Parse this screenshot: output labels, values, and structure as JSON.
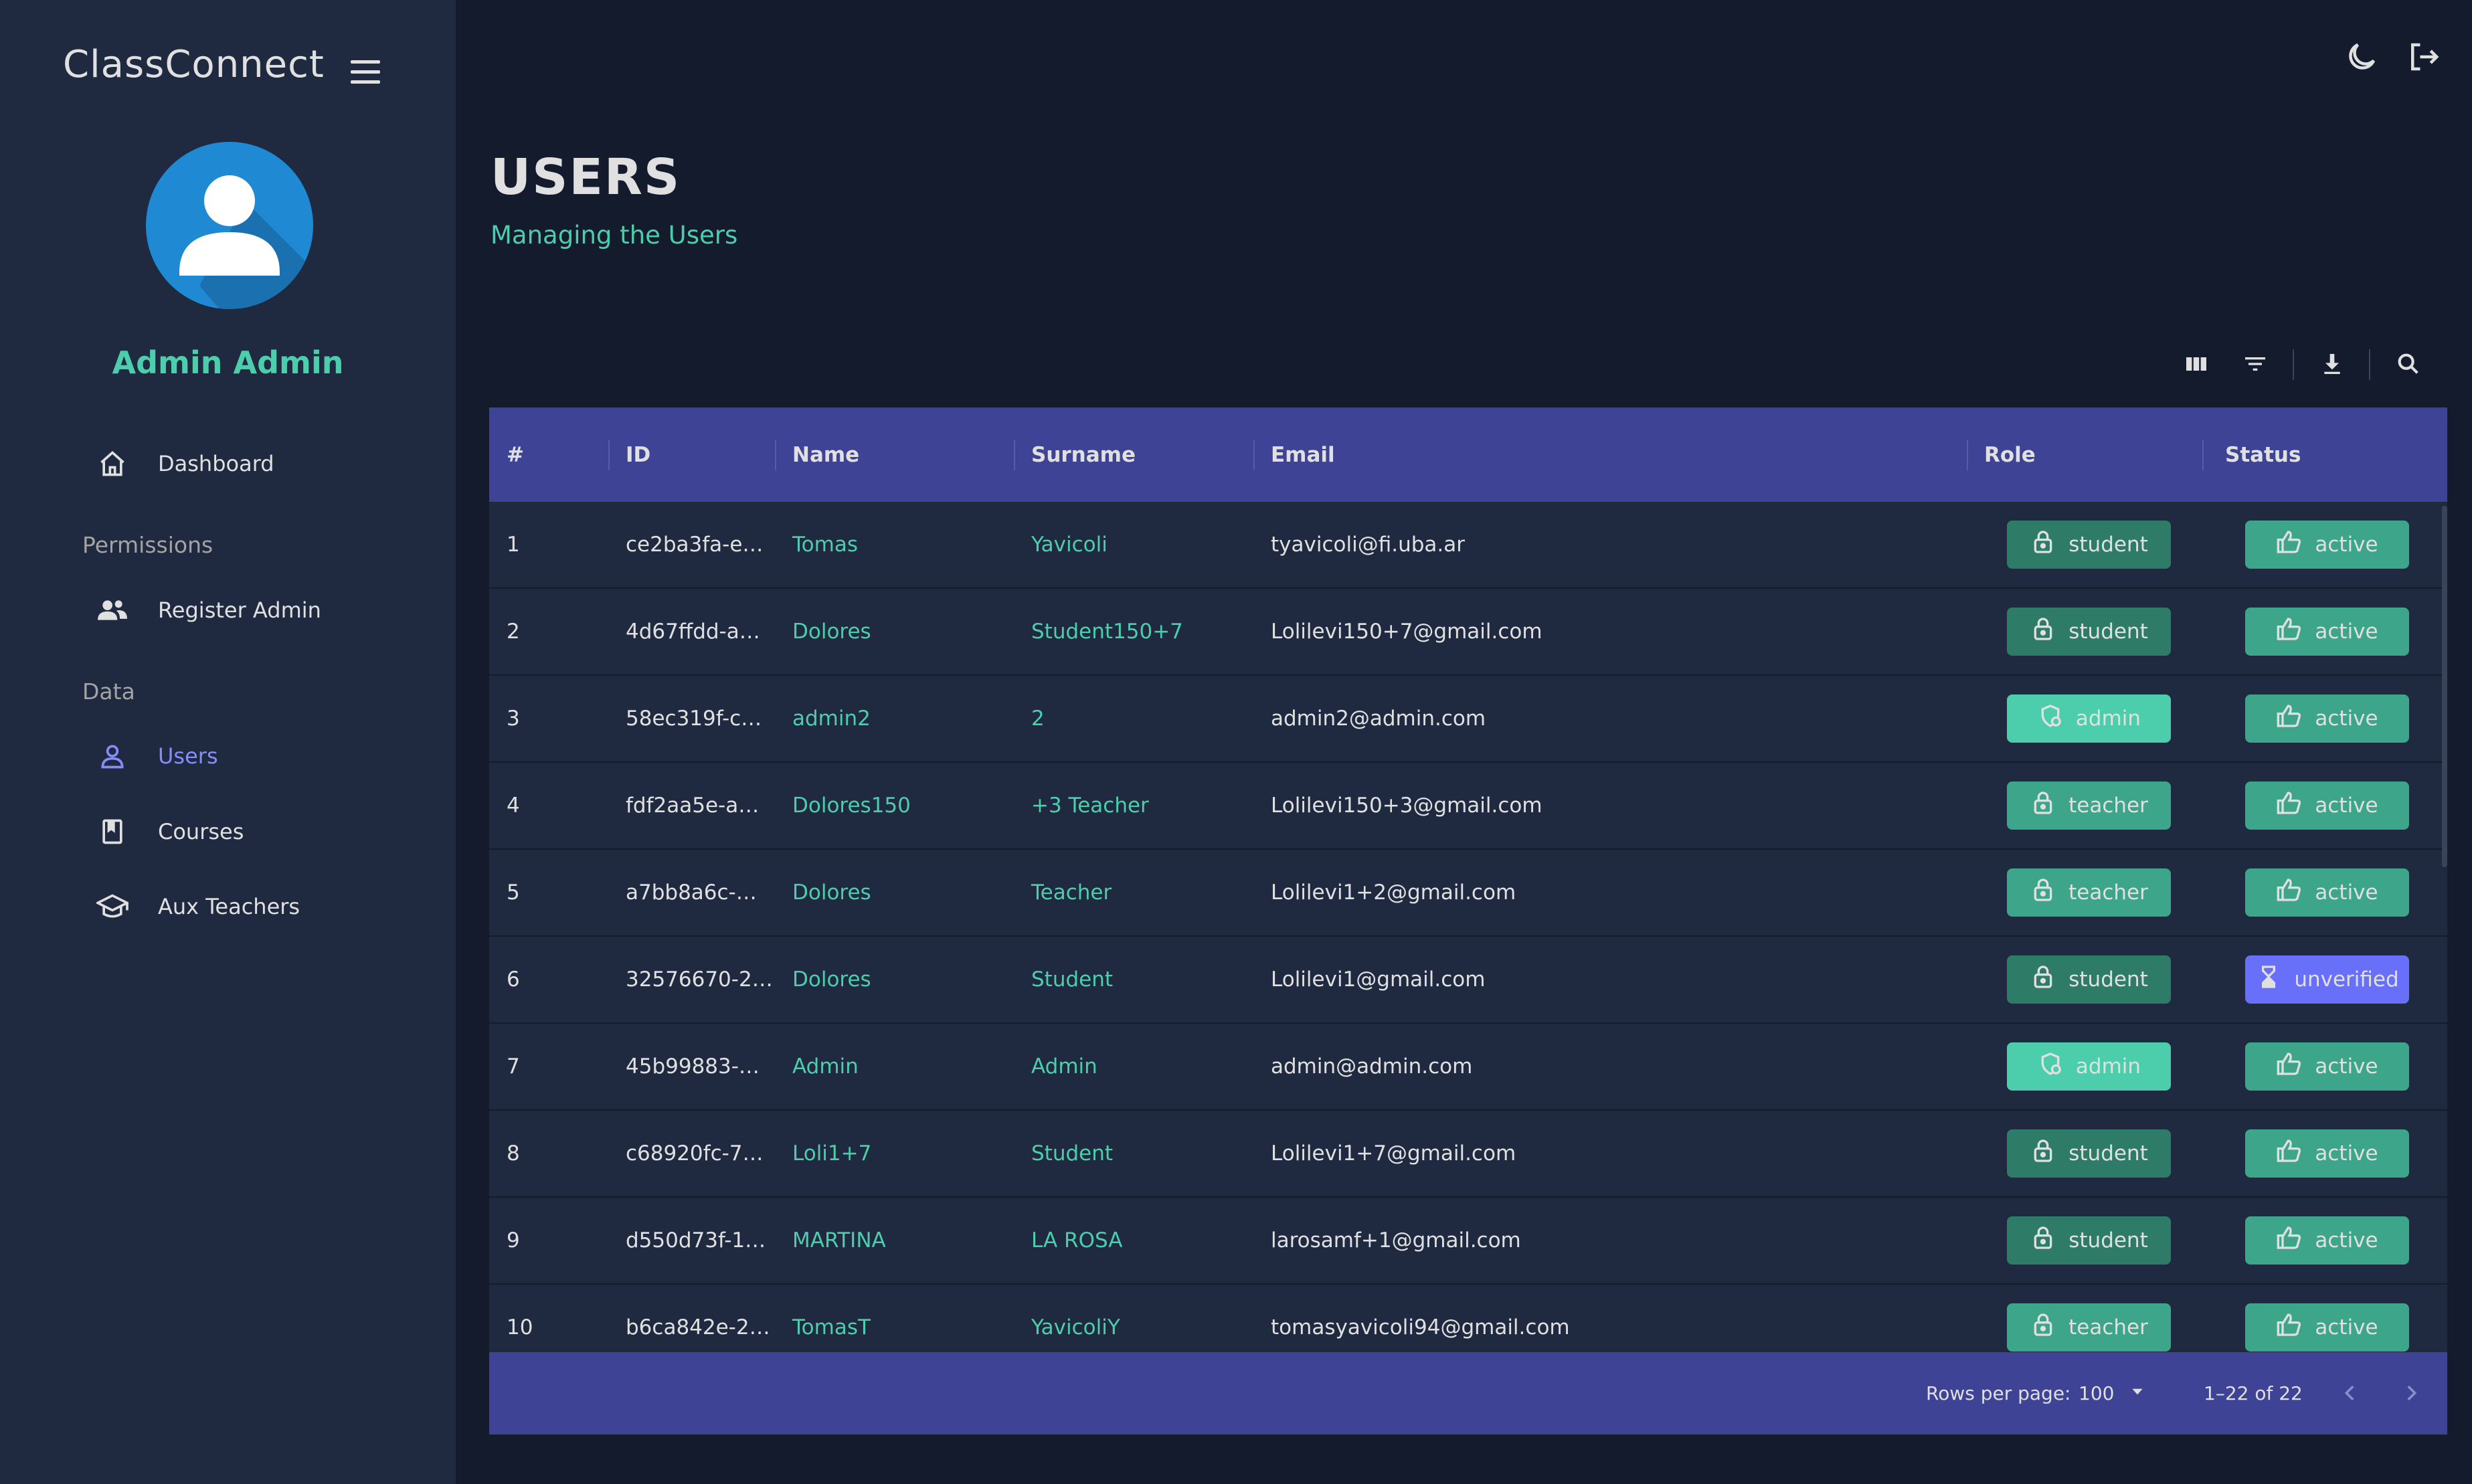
{
  "app": {
    "brand": "ClassConnect"
  },
  "profile": {
    "name": "Admin Admin"
  },
  "sidebar": {
    "items": [
      {
        "label": "Dashboard",
        "icon": "home-icon"
      },
      {
        "section": "Permissions"
      },
      {
        "label": "Register Admin",
        "icon": "people-icon"
      },
      {
        "section": "Data"
      },
      {
        "label": "Users",
        "icon": "person-icon",
        "active": true
      },
      {
        "label": "Courses",
        "icon": "book-icon"
      },
      {
        "label": "Aux Teachers",
        "icon": "school-icon"
      }
    ]
  },
  "topbar": {
    "icons": [
      "dark-mode-icon",
      "logout-icon"
    ]
  },
  "header": {
    "title": "USERS",
    "subtitle": "Managing the Users"
  },
  "toolbar": {
    "icons": [
      "columns-icon",
      "filter-icon",
      "download-icon",
      "search-icon"
    ]
  },
  "table": {
    "columns": [
      "#",
      "ID",
      "Name",
      "Surname",
      "Email",
      "Role",
      "Status"
    ],
    "rows": [
      {
        "n": "1",
        "id": "ce2ba3fa-e…",
        "name": "Tomas",
        "surname": "Yavicoli",
        "email": "tyavicoli@fi.uba.ar",
        "role": "student",
        "status": "active"
      },
      {
        "n": "2",
        "id": "4d67ffdd-a…",
        "name": "Dolores",
        "surname": "Student150+7",
        "email": "Lolilevi150+7@gmail.com",
        "role": "student",
        "status": "active"
      },
      {
        "n": "3",
        "id": "58ec319f-c…",
        "name": "admin2",
        "surname": "2",
        "email": "admin2@admin.com",
        "role": "admin",
        "status": "active"
      },
      {
        "n": "4",
        "id": "fdf2aa5e-a…",
        "name": "Dolores150",
        "surname": "+3 Teacher",
        "email": "Lolilevi150+3@gmail.com",
        "role": "teacher",
        "status": "active"
      },
      {
        "n": "5",
        "id": "a7bb8a6c-…",
        "name": "Dolores",
        "surname": "Teacher",
        "email": "Lolilevi1+2@gmail.com",
        "role": "teacher",
        "status": "active"
      },
      {
        "n": "6",
        "id": "32576670-2…",
        "name": "Dolores",
        "surname": "Student",
        "email": "Lolilevi1@gmail.com",
        "role": "student",
        "status": "unverified"
      },
      {
        "n": "7",
        "id": "45b99883-…",
        "name": "Admin",
        "surname": "Admin",
        "email": "admin@admin.com",
        "role": "admin",
        "status": "active"
      },
      {
        "n": "8",
        "id": "c68920fc-7…",
        "name": "Loli1+7",
        "surname": "Student",
        "email": "Lolilevi1+7@gmail.com",
        "role": "student",
        "status": "active"
      },
      {
        "n": "9",
        "id": "d550d73f-1…",
        "name": "MARTINA",
        "surname": "LA ROSA",
        "email": "larosamf+1@gmail.com",
        "role": "student",
        "status": "active"
      },
      {
        "n": "10",
        "id": "b6ca842e-2…",
        "name": "TomasT",
        "surname": "YavicoliY",
        "email": "tomasyavicoli94@gmail.com",
        "role": "teacher",
        "status": "active"
      }
    ]
  },
  "footer": {
    "rows_label": "Rows per page:",
    "rows_value": "100",
    "range": "1–22 of 22"
  },
  "colors": {
    "background": "#141b2d",
    "panel": "#1f2a40",
    "header": "#3e4396",
    "accent_green": "#4cceac",
    "student": "#2e7c67",
    "teacher": "#3da58a",
    "admin": "#4cceac",
    "active": "#3da58a",
    "unverified": "#6870fa",
    "active_nav": "#868dfb"
  }
}
